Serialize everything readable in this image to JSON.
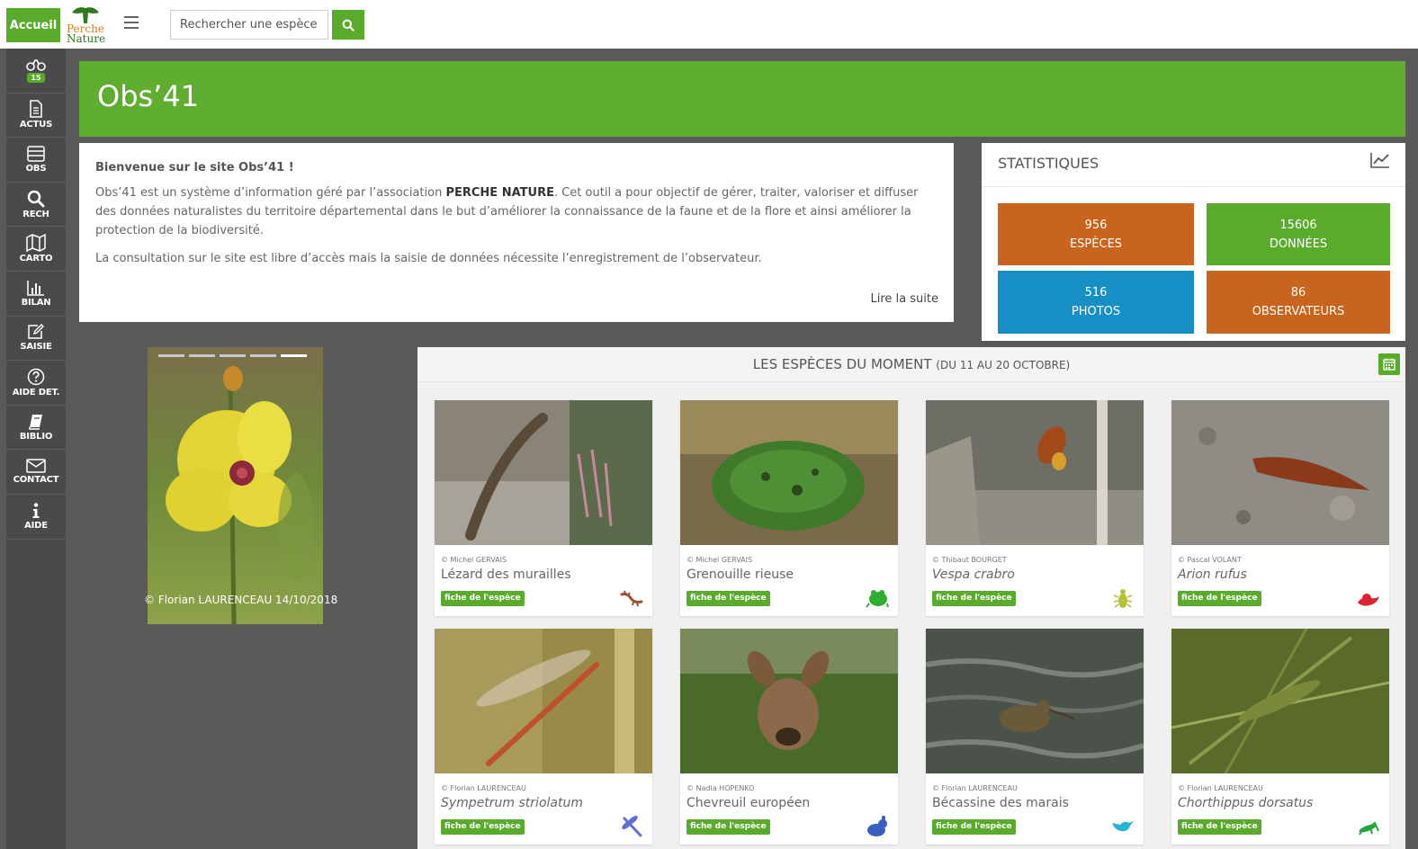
{
  "topbar": {
    "home_label": "Accueil",
    "logo_line1": "Perche",
    "logo_line2": "Nature",
    "search_placeholder": "Rechercher une espèce"
  },
  "sidebar": {
    "items": [
      {
        "icon": "binoculars-icon",
        "label": "",
        "badge": "15"
      },
      {
        "icon": "document-icon",
        "label": "ACTUS"
      },
      {
        "icon": "list-icon",
        "label": "OBS"
      },
      {
        "icon": "search-icon",
        "label": "RECH"
      },
      {
        "icon": "map-icon",
        "label": "CARTO"
      },
      {
        "icon": "bar-chart-icon",
        "label": "BILAN"
      },
      {
        "icon": "edit-icon",
        "label": "SAISIE"
      },
      {
        "icon": "question-icon",
        "label": "AIDE DET."
      },
      {
        "icon": "book-icon",
        "label": "BIBLIO"
      },
      {
        "icon": "envelope-icon",
        "label": "CONTACT"
      },
      {
        "icon": "info-icon",
        "label": "AIDE"
      }
    ]
  },
  "header": {
    "title": "Obs’41"
  },
  "welcome": {
    "title": "Bienvenue sur le site Obs’41 !",
    "p1_before": "Obs’41 est un système d’information géré par l’association ",
    "p1_bold": "PERCHE NATURE",
    "p1_after": ". Cet outil a pour objectif de gérer, traiter, valoriser et diffuser des données naturalistes du territoire départemental dans le but d’améliorer la connaissance de la faune et de la flore et ainsi améliorer la protection de la biodiversité.",
    "p2": "La consultation sur le site est libre d’accès mais la saisie de données nécessite l’enregistrement de l’observateur.",
    "read_more": "Lire la suite"
  },
  "stats": {
    "title": "STATISTIQUES",
    "items": [
      {
        "value": "956",
        "label": "ESPÈCES",
        "color": "#c8641e"
      },
      {
        "value": "15606",
        "label": "DONNÉES",
        "color": "#5aab2c"
      },
      {
        "value": "516",
        "label": "PHOTOS",
        "color": "#1690c4"
      },
      {
        "value": "86",
        "label": "OBSERVATEURS",
        "color": "#c8641e"
      }
    ]
  },
  "slider": {
    "credit": "© Florian LAURENCEAU 14/10/2018",
    "slides": 5,
    "active": 5
  },
  "species": {
    "title": "LES ESPÈCES DU MOMENT",
    "subtitle": "(DU 11 AU 20 OCTOBRE)",
    "fiche_label": "fiche de l'espèce",
    "cards": [
      {
        "credit": "© Michel GERVAIS",
        "name": "Lézard des murailles",
        "italic": false,
        "group": "reptile-icon",
        "group_color": "#a0522d"
      },
      {
        "credit": "© Michel GERVAIS",
        "name": "Grenouille rieuse",
        "italic": false,
        "group": "frog-icon",
        "group_color": "#2eae2e"
      },
      {
        "credit": "© Thibaut BOURGET",
        "name": "Vespa crabro",
        "italic": true,
        "group": "insect-icon",
        "group_color": "#b7c238"
      },
      {
        "credit": "© Pascal VOLANT",
        "name": "Arion rufus",
        "italic": true,
        "group": "mollusc-icon",
        "group_color": "#e0222e"
      },
      {
        "credit": "© Florian LAURENCEAU",
        "name": "Sympetrum striolatum",
        "italic": true,
        "group": "dragonfly-icon",
        "group_color": "#5f6fd8"
      },
      {
        "credit": "© Nadia HOPENKO",
        "name": "Chevreuil européen",
        "italic": false,
        "group": "mammal-icon",
        "group_color": "#3a5fc0"
      },
      {
        "credit": "© Florian LAURENCEAU",
        "name": "Bécassine des marais",
        "italic": false,
        "group": "bird-icon",
        "group_color": "#24b4d8"
      },
      {
        "credit": "© Florian LAURENCEAU",
        "name": "Chorthippus dorsatus",
        "italic": true,
        "group": "grasshopper-icon",
        "group_color": "#24a53a"
      }
    ]
  }
}
